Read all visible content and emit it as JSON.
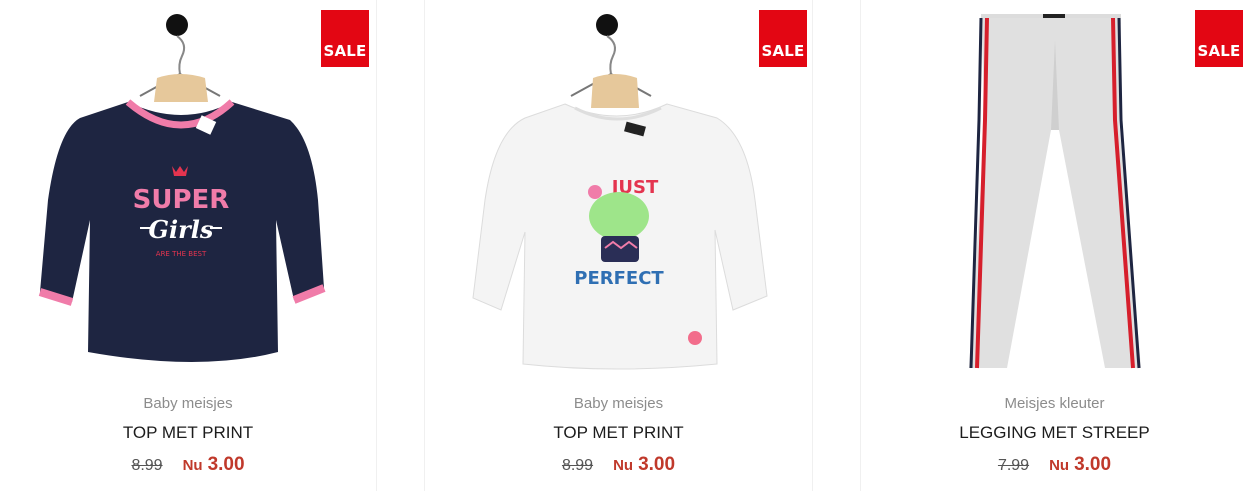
{
  "badge": {
    "label": "SALE",
    "color": "#e30613"
  },
  "price_color": "#c0392b",
  "products": [
    {
      "category": "Baby meisjes",
      "title": "TOP MET PRINT",
      "old_price": "8.99",
      "now_label": "Nu",
      "now_price": "3.00",
      "image": {
        "alt": "Navy long-sleeve top with pink trim",
        "print_line1": "SUPER",
        "print_line2": "Girls",
        "print_line3": "ARE THE BEST"
      }
    },
    {
      "category": "Baby meisjes",
      "title": "TOP MET PRINT",
      "old_price": "8.99",
      "now_label": "Nu",
      "now_price": "3.00",
      "image": {
        "alt": "White long-sleeve top with cactus print",
        "print_line1": "JUST",
        "print_line2": "PERFECT"
      }
    },
    {
      "category": "Meisjes kleuter",
      "title": "LEGGING MET STREEP",
      "old_price": "7.99",
      "now_label": "Nu",
      "now_price": "3.00",
      "image": {
        "alt": "Grey legging with red and navy side stripes"
      }
    }
  ]
}
